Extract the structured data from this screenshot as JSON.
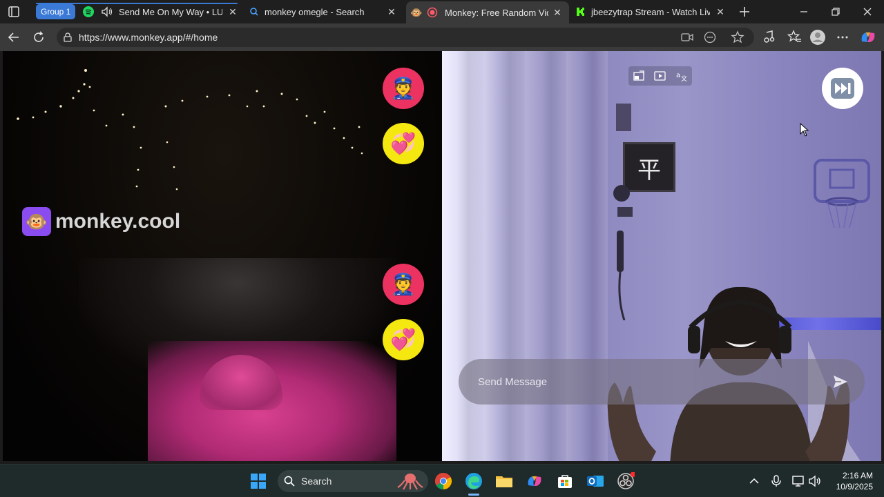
{
  "browser": {
    "tab_group": "Group 1",
    "tabs": [
      {
        "title": "Send Me On My Way • LUCK",
        "favicon": "spotify-icon",
        "audio": true
      },
      {
        "title": "monkey omegle - Search",
        "favicon": "search-icon"
      },
      {
        "title": "Monkey: Free Random Vide",
        "favicon": "monkey-icon",
        "recording": true,
        "active": true
      },
      {
        "title": "jbeezytrap Stream - Watch Live o",
        "favicon": "kick-icon"
      }
    ],
    "url": "https://www.monkey.app/#/home"
  },
  "page": {
    "brand": "monkey.cool",
    "left_buttons": [
      {
        "emoji": "👮",
        "name": "report"
      },
      {
        "emoji": "💞",
        "name": "like"
      },
      {
        "emoji": "👮",
        "name": "report"
      },
      {
        "emoji": "💞",
        "name": "like"
      }
    ],
    "skip_icon": "⏭",
    "message_placeholder": "Send Message",
    "poster_char": "平"
  },
  "taskbar": {
    "search_label": "Search",
    "time": "2:16 AM",
    "date": "10/9/2025"
  },
  "colors": {
    "accent": "#3b79d6",
    "police_bg": "#ec3261",
    "heart_bg": "#f5e810"
  }
}
